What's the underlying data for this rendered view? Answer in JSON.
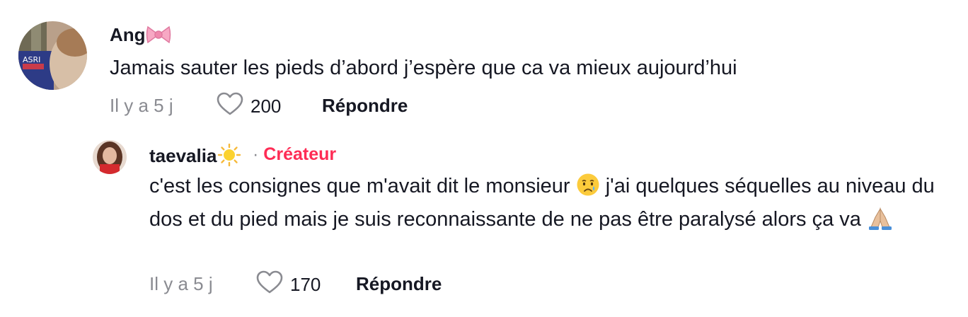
{
  "comments": [
    {
      "username": "Ang",
      "username_emoji_icon": "pink-bow-icon",
      "text": "Jamais sauter les pieds d’abord j’espère que ca va mieux aujourd’hui",
      "time": "Il y a 5 j",
      "likes": "200",
      "reply_label": "Répondre"
    }
  ],
  "replies": [
    {
      "username": "taevalia",
      "username_emoji_icon": "sun-icon",
      "badge_separator": "·",
      "badge_label": "Créateur",
      "text_part1": "c'est les consignes que m'avait dit le monsieur",
      "text_emoji1_icon": "crying-face-icon",
      "text_part2": "j'ai quelques séquelles au niveau du dos et du pied mais je suis reconnaissante de ne pas être paralysé alors ça va",
      "text_emoji2_icon": "folded-hands-icon",
      "time": "Il y a 5 j",
      "likes": "170",
      "reply_label": "Répondre"
    }
  ],
  "colors": {
    "text_primary": "#161823",
    "text_secondary": "#8a8b91",
    "creator_accent": "#fe2c55"
  }
}
